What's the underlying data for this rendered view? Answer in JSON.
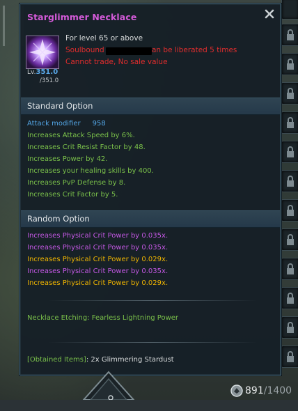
{
  "tooltip": {
    "title": "Starglimmer Necklace",
    "requirement": "For level 65 or above",
    "soulbound_prefix": "Soulbound",
    "soulbound_suffix": "an be liberated 5 times",
    "trade_status": "Cannot trade, No sale value",
    "level_label": "Lv.",
    "level_value": "351.0",
    "level_max": "/351.0",
    "standard_header": "Standard Option",
    "attack_label": "Attack modifier",
    "attack_value": "958",
    "standard_options": [
      "Increases Attack Speed by 6%.",
      "Increases Crit Resist Factor by 48.",
      "Increases Power by 42.",
      "Increases your healing skills by 400.",
      "Increases PvP Defense by 8.",
      "Increases Crit Factor by 5."
    ],
    "random_header": "Random Option",
    "random_options": [
      {
        "text": "Increases Physical Crit Power by 0.035x.",
        "tier": "purple"
      },
      {
        "text": "Increases Physical Crit Power by 0.035x.",
        "tier": "purple"
      },
      {
        "text": "Increases Physical Crit Power by 0.029x.",
        "tier": "gold"
      },
      {
        "text": "Increases Physical Crit Power by 0.035x.",
        "tier": "purple"
      },
      {
        "text": "Increases Physical Crit Power by 0.029x.",
        "tier": "gold"
      }
    ],
    "etching": "Necklace Etching: Fearless Lightning Power",
    "obtained_label": "[Obtained Items]",
    "obtained_value": ": 2x Glimmering Stardust"
  },
  "currency": {
    "current": "891",
    "separator": "/",
    "max": "1400",
    "icon": "coin-stack-icon"
  },
  "colors": {
    "title": "#d35ad8",
    "red": "#e22d2d",
    "green": "#7ac04a",
    "blue": "#53a6e6",
    "purple": "#c458e4",
    "gold": "#f0b500"
  }
}
